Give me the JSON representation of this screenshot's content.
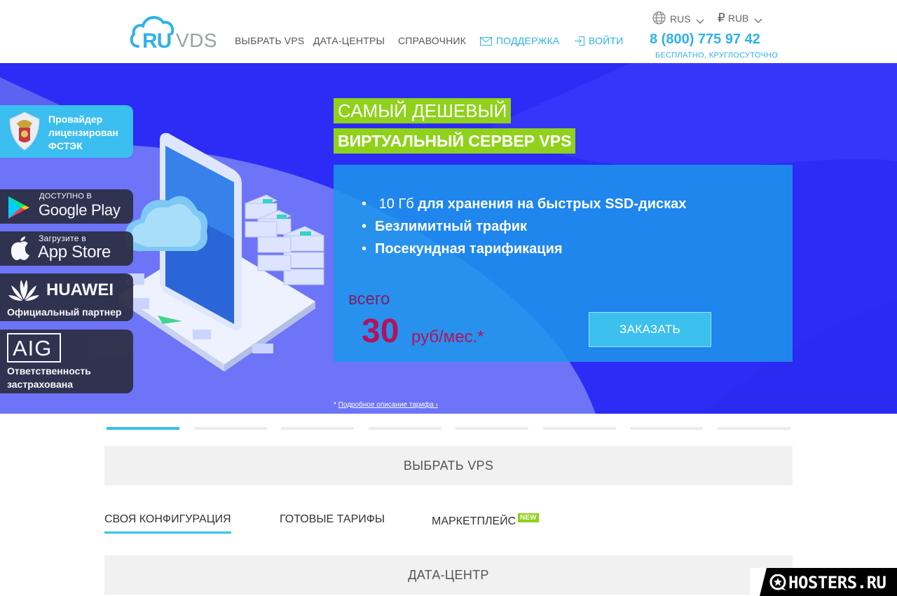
{
  "header": {
    "logo_ru": "RU",
    "logo_vds": "VDS",
    "nav": [
      "ВЫБРАТЬ VPS",
      "ДАТА-ЦЕНТРЫ",
      "СПРАВОЧНИК"
    ],
    "support": "ПОДДЕРЖКА",
    "login": "ВОЙТИ",
    "language": "RUS",
    "currency": "RUB",
    "phone": "8 (800) 775 97 42",
    "phone_note": "БЕСПЛАТНО, КРУГЛОСУТОЧНО"
  },
  "badges": {
    "fstek": [
      "Провайдер",
      "лицензирован",
      "ФСТЭК"
    ],
    "google_small": "ДОСТУПНО В",
    "google_big": "Google Play",
    "apple_small": "Загрузите в",
    "apple_big": "App Store",
    "huawei_brand": "HUAWEI",
    "huawei_note": "Официальный партнер",
    "aig_brand": "AIG",
    "aig_note": [
      "Ответственность",
      "застрахована"
    ]
  },
  "hero": {
    "title_1": "САМЫЙ ДЕШЕВЫЙ",
    "title_2": "ВИРТУАЛЬНЫЙ СЕРВЕР VPS",
    "feature_1_light": "10 Гб",
    "feature_1_bold": "для хранения на быстрых SSD-дисках",
    "feature_2": "Безлимитный трафик",
    "feature_3": "Посекундная тарификация",
    "price_prefix": "всего",
    "price": "30",
    "price_unit": "руб/мес.*",
    "order_button": "ЗАКАЗАТЬ",
    "footnote_star": "* ",
    "footnote_link": "Подробное описание тарифа ›"
  },
  "slider": {
    "count": 8,
    "active": 0
  },
  "sections": {
    "choose_vps": "ВЫБРАТЬ VPS",
    "tabs": [
      "СВОЯ КОНФИГУРАЦИЯ",
      "ГОТОВЫЕ ТАРИФЫ",
      "МАРКЕТПЛЕЙС"
    ],
    "new_tag": "NEW",
    "datacenter": "ДАТА-ЦЕНТР"
  },
  "watermark": "HOSTERS.RU",
  "colors": {
    "accent": "#3bbef0",
    "hero_bg": "#2f2dfa",
    "green": "#8fd11b",
    "price": "#b3125b"
  }
}
